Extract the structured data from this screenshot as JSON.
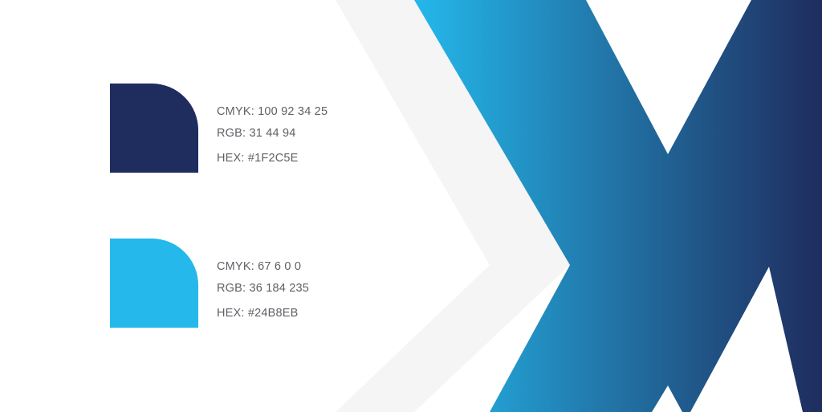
{
  "colors": {
    "background": "#FFFFFF",
    "chevron_gray": "#F5F5F6",
    "x_gradient_start": "#24B8EB",
    "x_gradient_end": "#1F2C5E",
    "spec_text": "#5F5F66"
  },
  "swatches": [
    {
      "hex_value": "#1F2C5E",
      "cmyk": "CMYK: 100 92 34 25",
      "rgb": "RGB: 31 44 94",
      "hex": "HEX: #1F2C5E"
    },
    {
      "hex_value": "#24B8EB",
      "cmyk": "CMYK: 67 6 0 0",
      "rgb": "RGB: 36 184 235",
      "hex": "HEX: #24B8EB"
    }
  ],
  "graphics": {
    "chevron": "gray-chevron-shape",
    "x_mark": "gradient-x-logo-mark"
  }
}
